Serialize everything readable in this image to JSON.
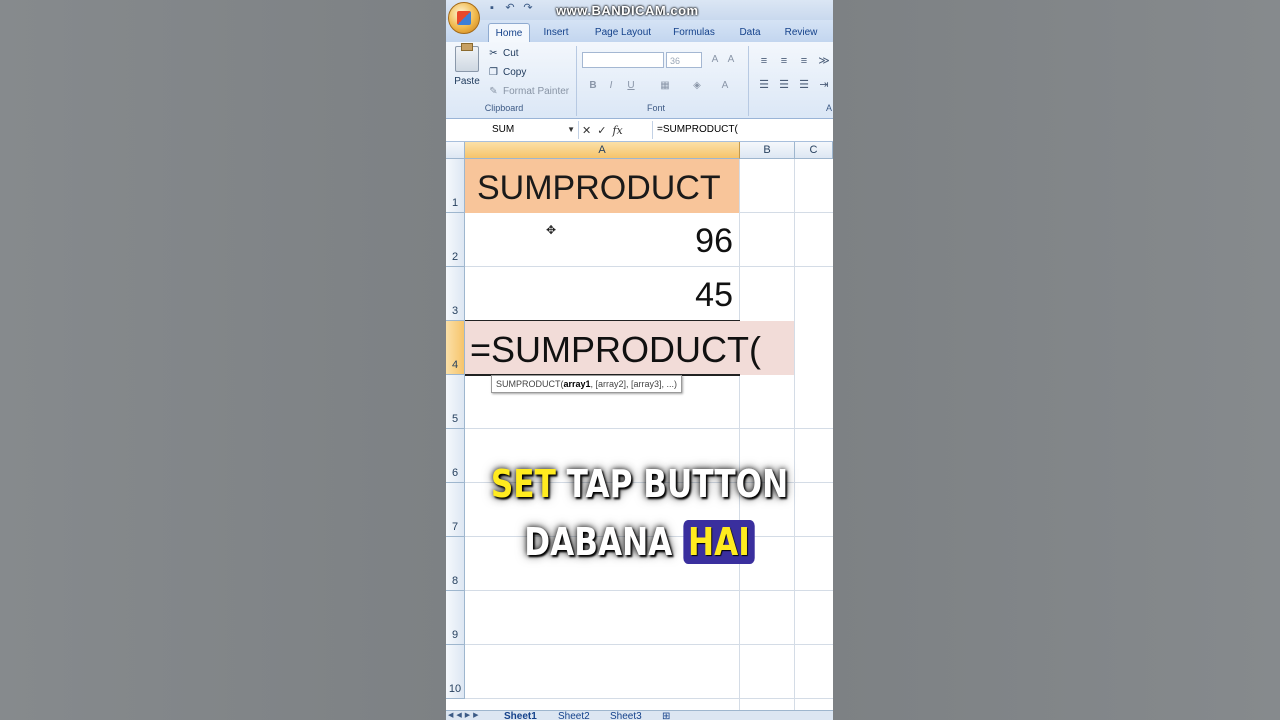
{
  "watermark": "www.BANDICAM.com",
  "tabs": [
    "Home",
    "Insert",
    "Page Layout",
    "Formulas",
    "Data",
    "Review"
  ],
  "ribbon": {
    "paste_label": "Paste",
    "cut_label": "Cut",
    "copy_label": "Copy",
    "format_painter_label": "Format Painter",
    "clipboard_group": "Clipboard",
    "font_size": "36",
    "font_group": "Font",
    "alignment_group_partial": "A"
  },
  "formula_bar": {
    "name_box": "SUM",
    "formula": "=SUMPRODUCT("
  },
  "columns": [
    "A",
    "B",
    "C"
  ],
  "rows": [
    "1",
    "2",
    "3",
    "4",
    "5",
    "6",
    "7",
    "8",
    "9",
    "10"
  ],
  "cells": {
    "A1": "SUMPRODUCT",
    "A2": "96",
    "A3": "45",
    "A4": "=SUMPRODUCT("
  },
  "tooltip": {
    "fn": "SUMPRODUCT(",
    "arg1": "array1",
    "rest": ", [array2], [array3], ...)"
  },
  "sheets": [
    "Sheet1",
    "Sheet2",
    "Sheet3"
  ],
  "caption": {
    "line1_highlight": "SET",
    "line1_rest": " TAP BUTTON",
    "line2_plain": "DABANA ",
    "line2_highlight": "HAI"
  },
  "colors": {
    "header_fill": "#f8c59a",
    "formula_cell_fill": "#f2dcd8",
    "caption_yellow": "#ffeb1f",
    "caption_box": "#3a2f9e"
  }
}
